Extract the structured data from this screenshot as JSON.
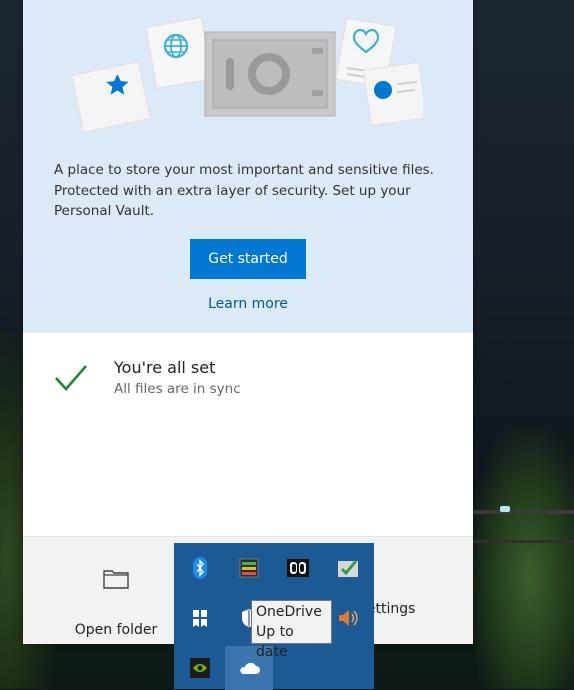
{
  "vault": {
    "description": "A place to store your most important and sensitive files. Protected with an extra layer of security. Set up your Personal Vault.",
    "get_started_label": "Get started",
    "learn_more_label": "Learn more"
  },
  "status": {
    "title": "You're all set",
    "subtitle": "All files are in sync"
  },
  "footer": {
    "open_folder_label": "Open folder",
    "settings_label": "Settings"
  },
  "tray": {
    "items": [
      "bluetooth-icon",
      "gpu-monitor-icon",
      "dolby-icon",
      "security-check-icon",
      "app-icon",
      "shield-icon",
      "speaker-icon",
      "nvidia-icon",
      "onedrive-cloud-icon"
    ],
    "active_item": "onedrive-cloud-icon"
  },
  "tooltip": {
    "line1": "OneDrive",
    "line2": "Up to date"
  },
  "colors": {
    "accent": "#0078d4",
    "link": "#005a9e",
    "vault_background": "#dce9f7",
    "check_green": "#1e8a2e",
    "tray_background": "#1c5a96"
  }
}
